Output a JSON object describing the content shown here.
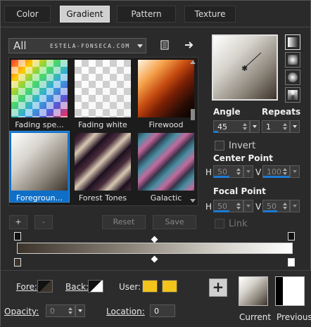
{
  "tabs": [
    {
      "label": "Color",
      "active": false
    },
    {
      "label": "Gradient",
      "active": true
    },
    {
      "label": "Pattern",
      "active": false
    },
    {
      "label": "Texture",
      "active": false
    }
  ],
  "category": {
    "value": "All",
    "watermark": "ESTELA-FONSECA.COM"
  },
  "swatches": [
    {
      "label": "Fading spe...",
      "selected": false
    },
    {
      "label": "Fading white",
      "selected": false
    },
    {
      "label": "Firewood",
      "selected": false
    },
    {
      "label": "Foregroun...",
      "selected": true
    },
    {
      "label": "Forest Tones",
      "selected": false
    },
    {
      "label": "Galactic",
      "selected": false
    }
  ],
  "properties": {
    "angle_label": "Angle",
    "angle_value": "45",
    "repeats_label": "Repeats",
    "repeats_value": "1",
    "invert_label": "Invert",
    "center_point_label": "Center Point",
    "center_h": "50",
    "center_v": "100",
    "focal_point_label": "Focal Point",
    "focal_h": "50",
    "focal_v": "50",
    "link_label": "Link",
    "h_label": "H",
    "v_label": "V"
  },
  "buttons": {
    "add": "+",
    "remove": "-",
    "reset": "Reset",
    "save": "Save"
  },
  "bottom": {
    "fore_label": "Fore:",
    "back_label": "Back:",
    "user_label": "User:",
    "opacity_label": "Opacity:",
    "opacity_value": "0",
    "location_label": "Location:",
    "location_value": "0",
    "current_label": "Current",
    "previous_label": "Previous"
  },
  "colors": {
    "accent": "#1e7ad2",
    "user_color_1": "#f2c31a",
    "user_color_2": "#f2c31a"
  }
}
